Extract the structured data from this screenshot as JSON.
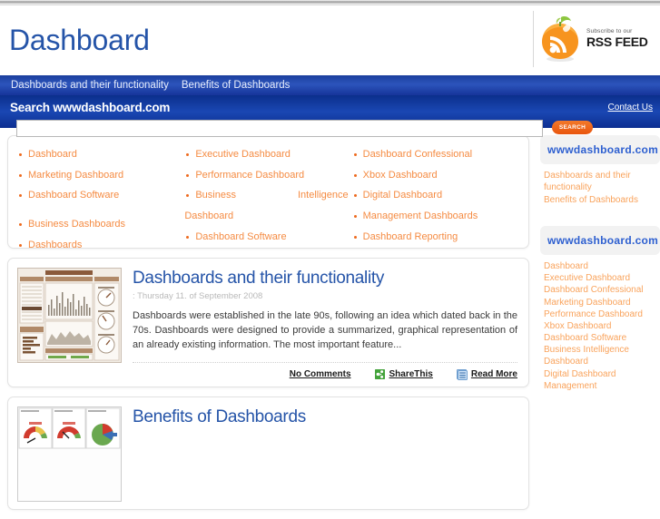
{
  "header": {
    "site_title": "Dashboard",
    "rss": {
      "subscribe_text": "Subscribe to our",
      "feed_text": "RSS FEED"
    }
  },
  "nav": {
    "items": [
      {
        "label": "Dashboards and their functionality"
      },
      {
        "label": "Benefits of Dashboards"
      }
    ]
  },
  "search": {
    "label": "Search wwwdashboard.com",
    "contact_label": "Contact Us",
    "input_value": "",
    "input_placeholder": "",
    "button_label": "SEARCH"
  },
  "keywords": {
    "col1": [
      "Dashboard",
      "Marketing Dashboard",
      "Dashboard Software",
      "Business Dashboards",
      "Dashboards"
    ],
    "col2_a": "Executive Dashboard",
    "col2_b": "Performance Dashboard",
    "col2_c_left": "Business",
    "col2_c_right": "Intelligence",
    "col2_c_wrap": "Dashboard",
    "col2_d": "Dashboard Software",
    "col3": [
      "Dashboard Confessional",
      "Xbox Dashboard",
      "Digital Dashboard",
      "Management Dashboards",
      "Dashboard Reporting"
    ]
  },
  "articles": [
    {
      "title": "Dashboards and their functionality",
      "date": ": Thursday 11. of September 2008",
      "excerpt": "Dashboards were established in the late 90s, following an idea which dated back in the 70s. Dashboards were designed to provide a summarized, graphical representation of an already existing information. The most important feature...",
      "comments_label": "No Comments",
      "share_label": "ShareThis",
      "read_more_label": "Read More"
    },
    {
      "title": "Benefits of Dashboards"
    }
  ],
  "sidebar": {
    "links_heading": "wwwdashboard.com Links",
    "links": [
      "Dashboards and their functionality",
      "Benefits of Dashboards"
    ],
    "categories_heading": "wwwdashboard.com Categories",
    "categories": [
      "Dashboard",
      "Executive Dashboard",
      "Dashboard Confessional",
      "Marketing Dashboard",
      "Performance Dashboard",
      "Xbox Dashboard",
      "Dashboard Software",
      "Business Intelligence Dashboard",
      "Digital Dashboard",
      "Management"
    ]
  },
  "colors": {
    "brand_blue": "#2554a8",
    "nav_blue": "#1b3f9e",
    "accent_orange": "#f58b42",
    "search_orange": "#e9550d"
  }
}
